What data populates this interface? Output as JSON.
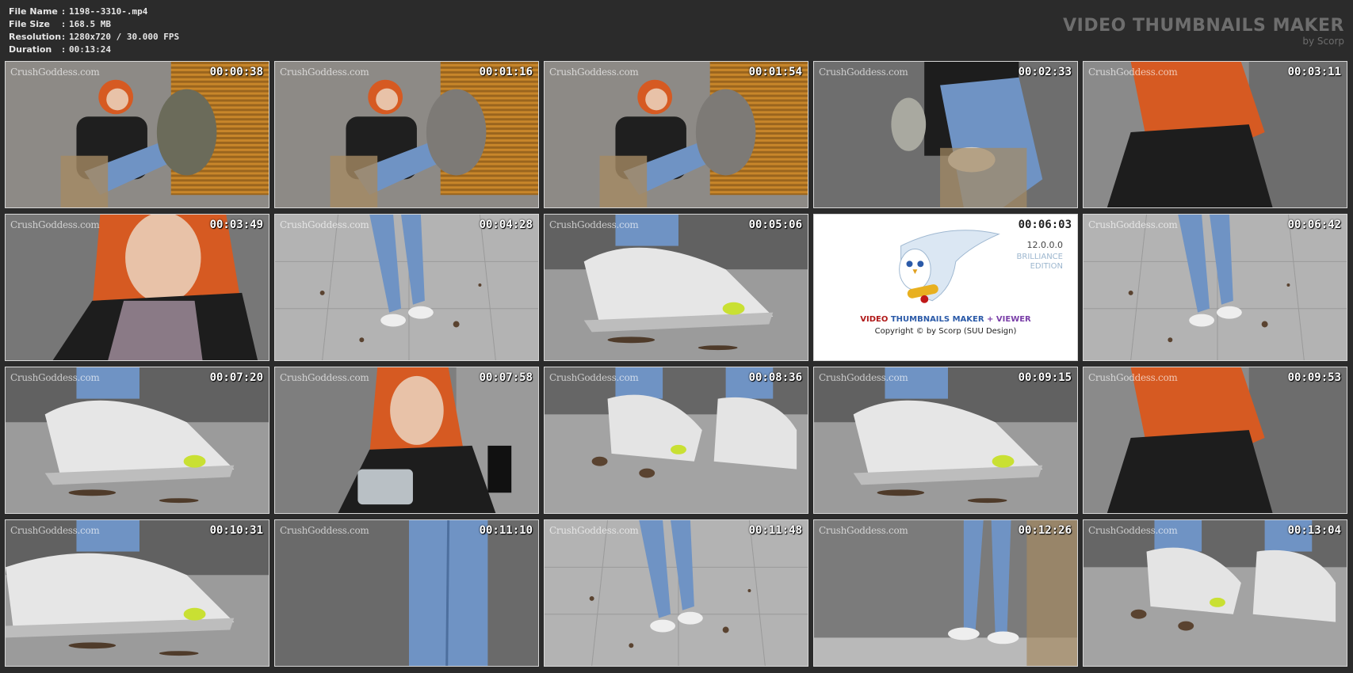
{
  "file_info": [
    {
      "key": "File Name",
      "value": "1198--3310-.mp4"
    },
    {
      "key": "File Size",
      "value": "168.5 MB"
    },
    {
      "key": "Resolution",
      "value": "1280x720 / 30.000 FPS"
    },
    {
      "key": "Duration",
      "value": "00:13:24"
    }
  ],
  "separator": ":",
  "brand": {
    "title": "VIDEO THUMBNAILS MAKER",
    "subtitle": "by Scorp"
  },
  "watermark": "CrushGoddess.com",
  "thumbnails": [
    {
      "time": "00:00:38",
      "scene": "sitting-woman-shoe-sole"
    },
    {
      "time": "00:01:16",
      "scene": "sitting-woman-sock"
    },
    {
      "time": "00:01:54",
      "scene": "sitting-woman-socks-phone"
    },
    {
      "time": "00:02:33",
      "scene": "legs-crossed-chair"
    },
    {
      "time": "00:03:11",
      "scene": "woman-back-view"
    },
    {
      "time": "00:03:49",
      "scene": "woman-closeup"
    },
    {
      "time": "00:04:28",
      "scene": "walking-tiles"
    },
    {
      "time": "00:05:06",
      "scene": "sneaker-floor"
    },
    {
      "time": "00:06:03",
      "scene": "logo"
    },
    {
      "time": "00:06:42",
      "scene": "walking-tiles"
    },
    {
      "time": "00:07:20",
      "scene": "sneaker-closeup"
    },
    {
      "time": "00:07:58",
      "scene": "woman-container"
    },
    {
      "time": "00:08:36",
      "scene": "two-sneakers"
    },
    {
      "time": "00:09:15",
      "scene": "sneaker-closeup"
    },
    {
      "time": "00:09:53",
      "scene": "woman-back-view"
    },
    {
      "time": "00:10:31",
      "scene": "sneaker-floor-left"
    },
    {
      "time": "00:11:10",
      "scene": "jeans-closeup"
    },
    {
      "time": "00:11:48",
      "scene": "walking-tiles"
    },
    {
      "time": "00:12:26",
      "scene": "standing-legs"
    },
    {
      "time": "00:13:04",
      "scene": "two-sneakers"
    }
  ],
  "logo_tile": {
    "version": "12.0.0.0",
    "edition": "BRILLIANCE\nEDITION",
    "name_part1": "VIDEO",
    "name_part2": "THUMBNAILS MAKER",
    "name_part3": "+ VIEWER",
    "copyright": "Copyright © by Scorp (SUU Design)"
  },
  "colors": {
    "background": "#2b2b2b",
    "border": "#d8d8d8",
    "brand_text": "#6d6d6d",
    "skin_hair": "#d65a22",
    "jeans": "#6f93c4"
  }
}
